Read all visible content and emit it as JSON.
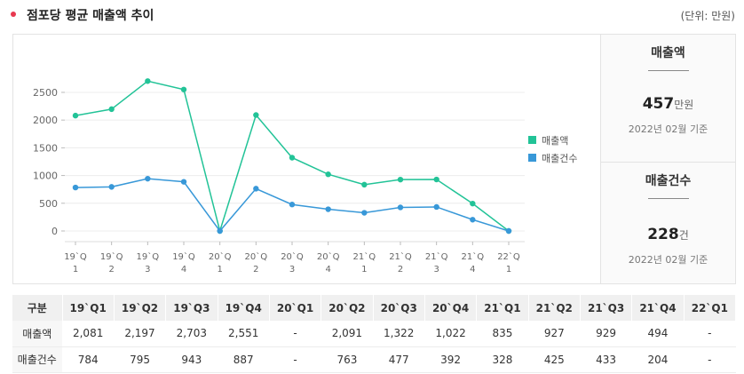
{
  "header": {
    "title": "점포당 평균 매출액 추이",
    "unit": "(단위: 만원)"
  },
  "colors": {
    "accent": "#e8384f",
    "sales": "#22c397",
    "count": "#3898d8"
  },
  "chart_data": {
    "type": "line",
    "x": [
      "19`Q1",
      "19`Q2",
      "19`Q3",
      "19`Q4",
      "20`Q1",
      "20`Q2",
      "20`Q3",
      "20`Q4",
      "21`Q1",
      "21`Q2",
      "21`Q3",
      "21`Q4",
      "22`Q1"
    ],
    "x_tick_labels": [
      [
        "19`Q",
        "1"
      ],
      [
        "19`Q",
        "2"
      ],
      [
        "19`Q",
        "3"
      ],
      [
        "19`Q",
        "4"
      ],
      [
        "20`Q",
        "1"
      ],
      [
        "20`Q",
        "2"
      ],
      [
        "20`Q",
        "3"
      ],
      [
        "20`Q",
        "4"
      ],
      [
        "21`Q",
        "1"
      ],
      [
        "21`Q",
        "2"
      ],
      [
        "21`Q",
        "3"
      ],
      [
        "21`Q",
        "4"
      ],
      [
        "22`Q",
        "1"
      ]
    ],
    "series": [
      {
        "name": "매출액",
        "values": [
          2081,
          2197,
          2703,
          2551,
          0,
          2091,
          1322,
          1022,
          835,
          927,
          929,
          494,
          0
        ]
      },
      {
        "name": "매출건수",
        "values": [
          784,
          795,
          943,
          887,
          0,
          763,
          477,
          392,
          328,
          425,
          433,
          204,
          0
        ]
      }
    ],
    "ylim": [
      0,
      2500
    ],
    "yticks": [
      0,
      500,
      1000,
      1500,
      2000,
      2500
    ],
    "grid": true,
    "legend": "right"
  },
  "summary": {
    "sales": {
      "title": "매출액",
      "value": "457",
      "unit": "만원",
      "date": "2022년 02월 기준"
    },
    "count": {
      "title": "매출건수",
      "value": "228",
      "unit": "건",
      "date": "2022년 02월 기준"
    }
  },
  "table": {
    "corner": "구분",
    "headers": [
      "19`Q1",
      "19`Q2",
      "19`Q3",
      "19`Q4",
      "20`Q1",
      "20`Q2",
      "20`Q3",
      "20`Q4",
      "21`Q1",
      "21`Q2",
      "21`Q3",
      "21`Q4",
      "22`Q1"
    ],
    "rows": [
      {
        "label": "매출액",
        "cells": [
          "2,081",
          "2,197",
          "2,703",
          "2,551",
          "-",
          "2,091",
          "1,322",
          "1,022",
          "835",
          "927",
          "929",
          "494",
          "-"
        ]
      },
      {
        "label": "매출건수",
        "cells": [
          "784",
          "795",
          "943",
          "887",
          "-",
          "763",
          "477",
          "392",
          "328",
          "425",
          "433",
          "204",
          "-"
        ]
      }
    ]
  }
}
